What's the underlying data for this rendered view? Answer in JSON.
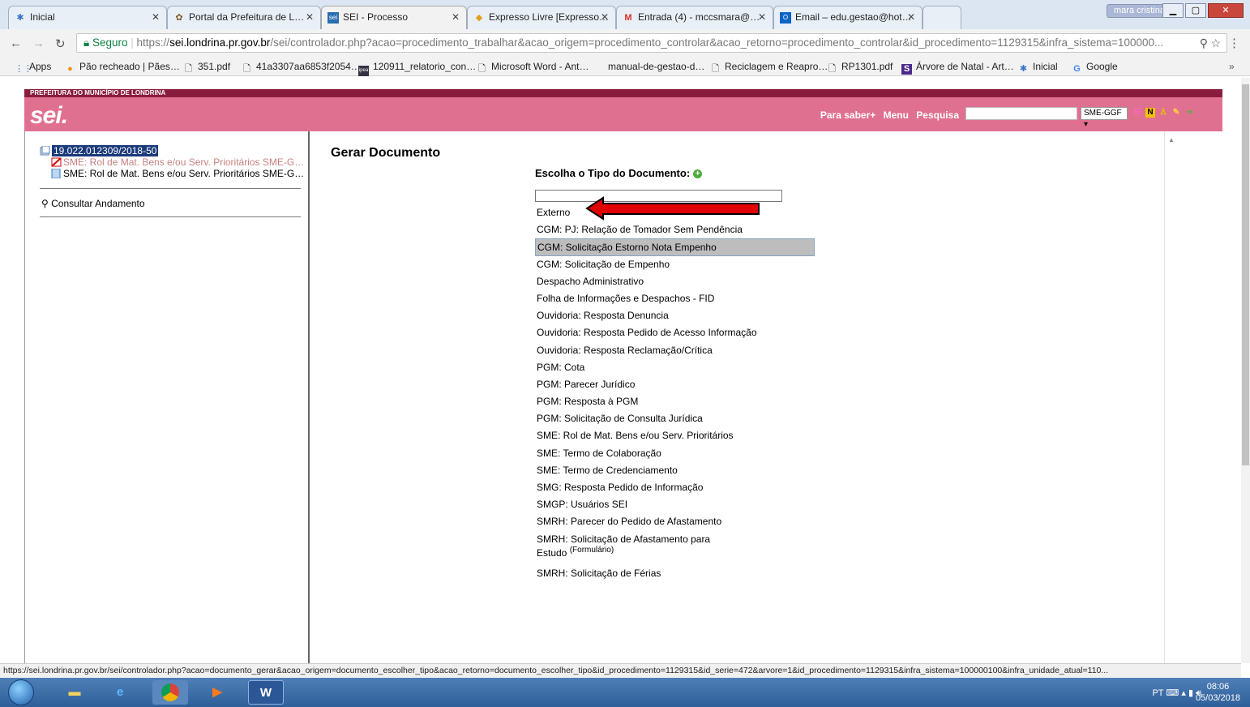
{
  "browser": {
    "tabs": [
      {
        "label": "Inicial",
        "icon": "puzzle-icon"
      },
      {
        "label": "Portal da Prefeitura de L…",
        "icon": "crest-icon"
      },
      {
        "label": "SEI - Processo",
        "icon": "sei-icon",
        "active": true
      },
      {
        "label": "Expresso Livre [Expresso…",
        "icon": "expresso-icon"
      },
      {
        "label": "Entrada (4) - mccsmara@…",
        "icon": "gmail-icon"
      },
      {
        "label": "Email – edu.gestao@hot…",
        "icon": "outlook-icon"
      }
    ],
    "window_user": "mara cristina",
    "url_secure": "Seguro",
    "url_scheme": "https://",
    "url_host": "sei.londrina.pr.gov.br",
    "url_rest": "/sei/controlador.php?acao=procedimento_trabalhar&acao_origem=procedimento_controlar&acao_retorno=procedimento_controlar&id_procedimento=1129315&infra_sistema=100000...",
    "bookmarks": [
      "Apps",
      "Pão recheado | Pães…",
      "351.pdf",
      "41a3307aa6853f2054…",
      "120911_relatorio_con…",
      "Microsoft Word - Ant…",
      "manual-de-gestao-d…",
      "Reciclagem e Reapro…",
      "RP1301.pdf",
      "Árvore de Natal - Art…",
      "Inicial",
      "Google"
    ],
    "status_url": "https://sei.londrina.pr.gov.br/sei/controlador.php?acao=documento_gerar&acao_origem=documento_escolher_tipo&acao_retorno=documento_escolher_tipo&id_procedimento=1129315&id_serie=472&arvore=1&id_procedimento=1129315&infra_sistema=100000100&infra_unidade_atual=110..."
  },
  "sei": {
    "org": "PREFEITURA DO MUNICÍPIO DE LONDRINA",
    "logo": "sei.",
    "links": [
      "Para saber+",
      "Menu",
      "Pesquisa"
    ],
    "unit": "SME-GGF"
  },
  "tree": {
    "process": "19.022.012309/2018-50",
    "docs": [
      "SME: Rol de Mat. Bens e/ou Serv. Prioritários SME-G…",
      "SME: Rol de Mat. Bens e/ou Serv. Prioritários SME-G…"
    ],
    "consult": "Consultar Andamento"
  },
  "main": {
    "title": "Gerar Documento",
    "choose": "Escolha o Tipo do Documento:",
    "filter_value": "",
    "options": [
      "Externo",
      "CGM: PJ: Relação de Tomador Sem Pendência",
      "CGM: Solicitação Estorno Nota Empenho",
      "CGM: Solicitação de Empenho",
      "Despacho Administrativo",
      "Folha de Informações e Despachos - FID",
      "Ouvidoria: Resposta Denuncia",
      "Ouvidoria: Resposta Pedido de Acesso Informação",
      "Ouvidoria: Resposta Reclamação/Crítica",
      "PGM: Cota",
      "PGM: Parecer Jurídico",
      "PGM: Resposta à PGM",
      "PGM: Solicitação de Consulta Jurídica",
      "SME: Rol de Mat. Bens e/ou Serv. Prioritários",
      "SME: Termo de Colaboração",
      "SME: Termo de Credenciamento",
      "SMG: Resposta Pedido de Informação",
      "SMGP: Usuários SEI",
      "SMRH: Parecer do Pedido de Afastamento"
    ],
    "selected_option": "CGM: Solicitação Estorno Nota Empenho",
    "option_two_line": "SMRH: Solicitação de Afastamento para Estudo",
    "option_two_line_sup": "(Formulário)",
    "option_last": "SMRH: Solicitação de Férias"
  },
  "taskbar": {
    "lang": "PT",
    "time": "08:06",
    "date": "05/03/2018"
  },
  "colors": {
    "sei_dark": "#8a1c3d",
    "sei_pink": "#e07090",
    "arrow_red": "#e00000"
  }
}
